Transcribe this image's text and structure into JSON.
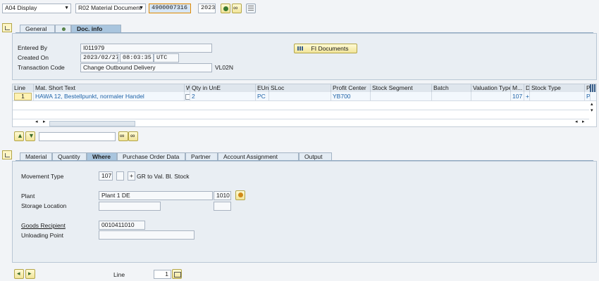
{
  "toolbar": {
    "action": "A04 Display",
    "reference": "R02 Material Document",
    "doc_number": "4900007316",
    "year": "2023"
  },
  "header_tabs": [
    "General",
    "",
    "Doc. info"
  ],
  "doc_info": {
    "entered_by_label": "Entered By",
    "entered_by": "I011979",
    "created_on_label": "Created On",
    "created_date": "2023/02/27",
    "created_time": "08:03:35",
    "created_tz": "UTC",
    "tcode_label": "Transaction Code",
    "tcode_text": "Change Outbound Delivery",
    "tcode": "VL02N",
    "fi_button": "FI Documents"
  },
  "grid": {
    "columns": [
      "Line",
      "Mat. Short Text",
      "W",
      "Qty in UnE",
      "EUn",
      "SLoc",
      "Profit Center",
      "Stock Segment",
      "Batch",
      "Valuation Type",
      "M...",
      "D",
      "Stock Type",
      "P"
    ],
    "row": {
      "line": "1",
      "text": "HAWA 12, Bestellpunkt, normaler Handel",
      "qty": "2",
      "eun": "PC",
      "profit_center": "YB700",
      "mvt": "107",
      "d": "+",
      "p": "P"
    }
  },
  "detail_tabs": [
    "Material",
    "Quantity",
    "Where",
    "Purchase Order Data",
    "Partner",
    "Account Assignment",
    "Output"
  ],
  "where": {
    "movement_type_label": "Movement Type",
    "movement_type": "107",
    "sign": "+",
    "movement_desc": "GR to Val. Bl. Stock",
    "plant_label": "Plant",
    "plant_name": "Plant 1 DE",
    "plant_code": "1010",
    "storage_label": "Storage Location",
    "goods_recipient_label": "Goods Recipient",
    "goods_recipient": "0010411010",
    "unloading_label": "Unloading Point"
  },
  "footer": {
    "line_label": "Line",
    "line_value": "1"
  },
  "colors": {
    "accent": "#a9c5de",
    "link": "#1f63a8",
    "button": "#f1e49a"
  }
}
